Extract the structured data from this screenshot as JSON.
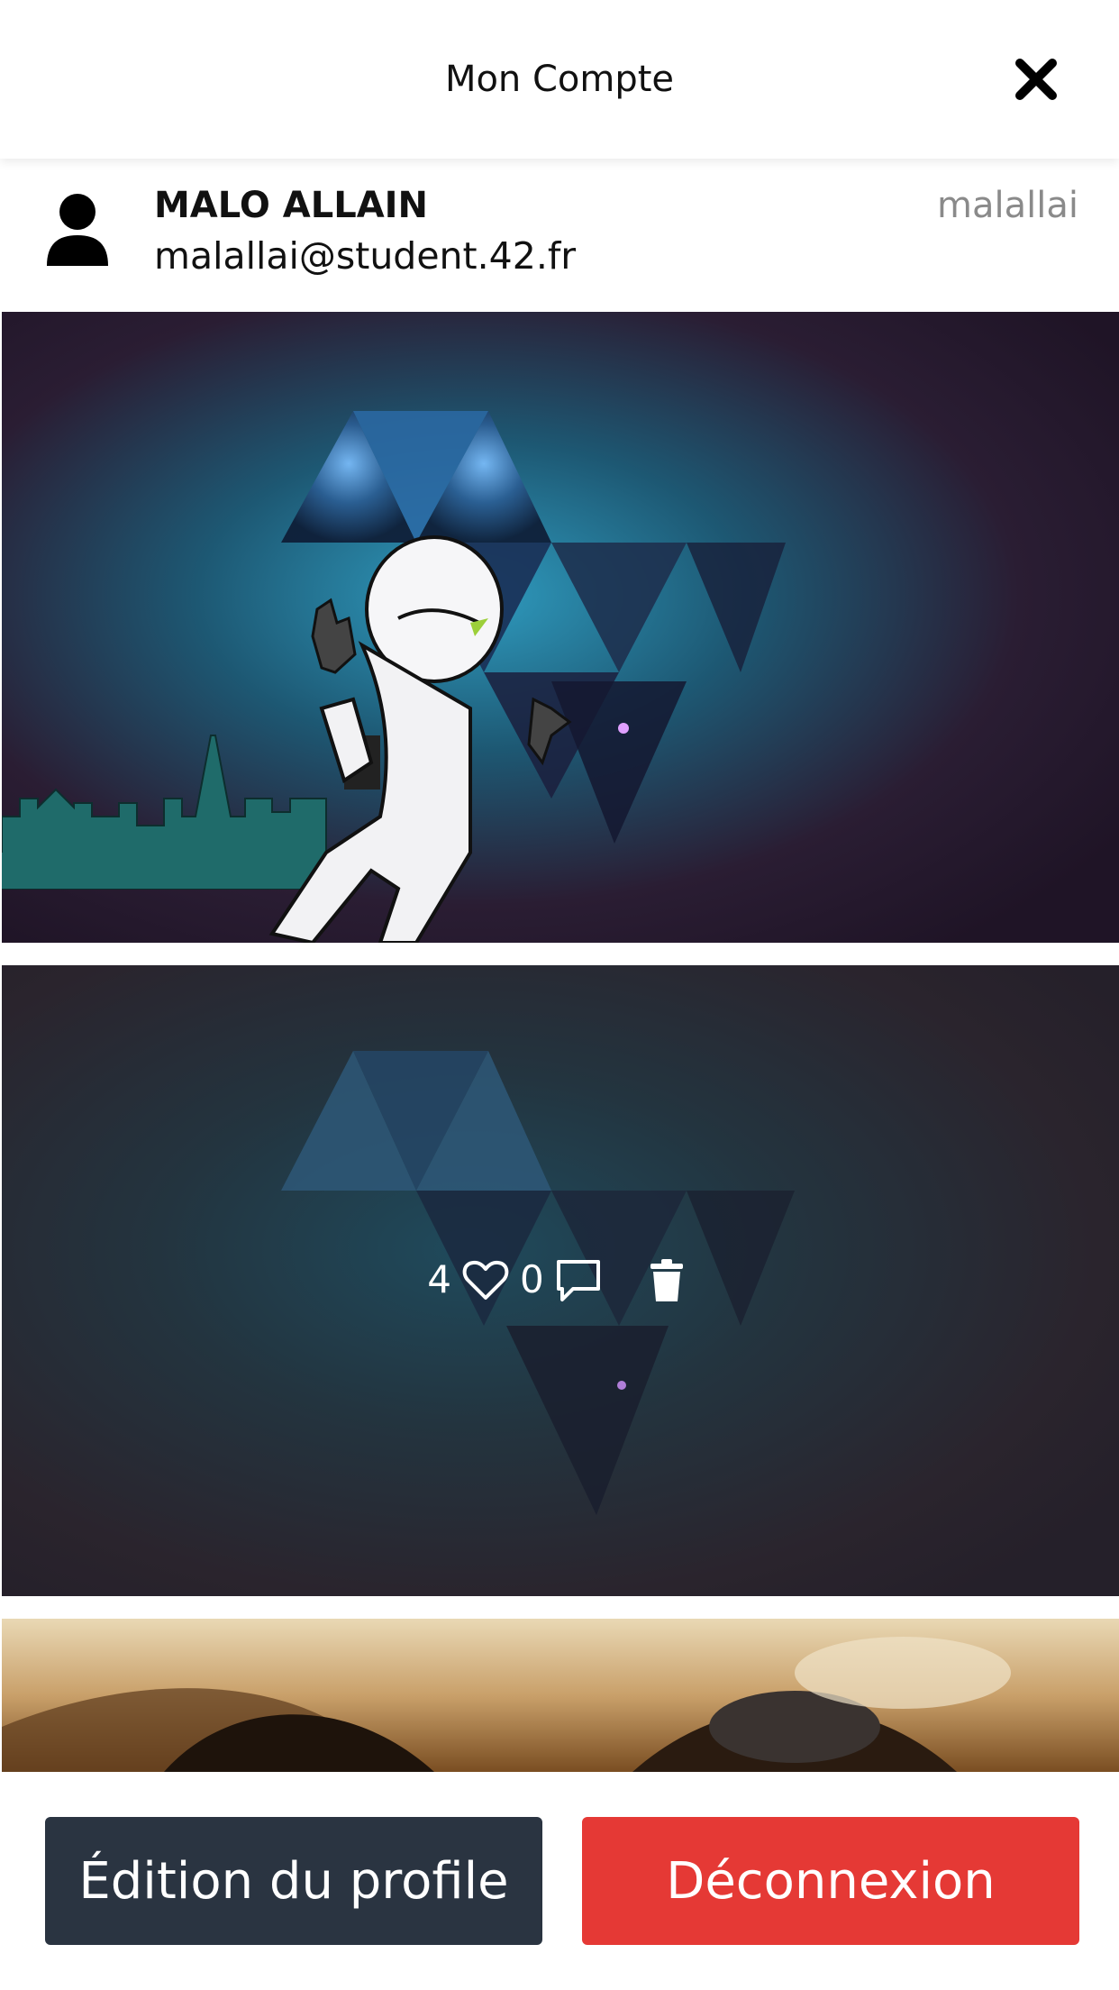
{
  "header": {
    "title": "Mon Compte",
    "close_icon": "close-icon"
  },
  "user": {
    "full_name": "MALO ALLAIN",
    "email": "malallai@student.42.fr",
    "login": "malallai",
    "avatar_icon": "user-icon"
  },
  "posts": [
    {
      "overlay": false
    },
    {
      "overlay": true,
      "likes": "4",
      "comments": "0",
      "icons": [
        "heart-icon",
        "comment-icon",
        "trash-icon"
      ]
    },
    {
      "overlay": false
    }
  ],
  "actions": {
    "edit_label": "Édition du profile",
    "logout_label": "Déconnexion"
  },
  "colors": {
    "edit_button": "#2a3441",
    "logout_button": "#e53935"
  }
}
